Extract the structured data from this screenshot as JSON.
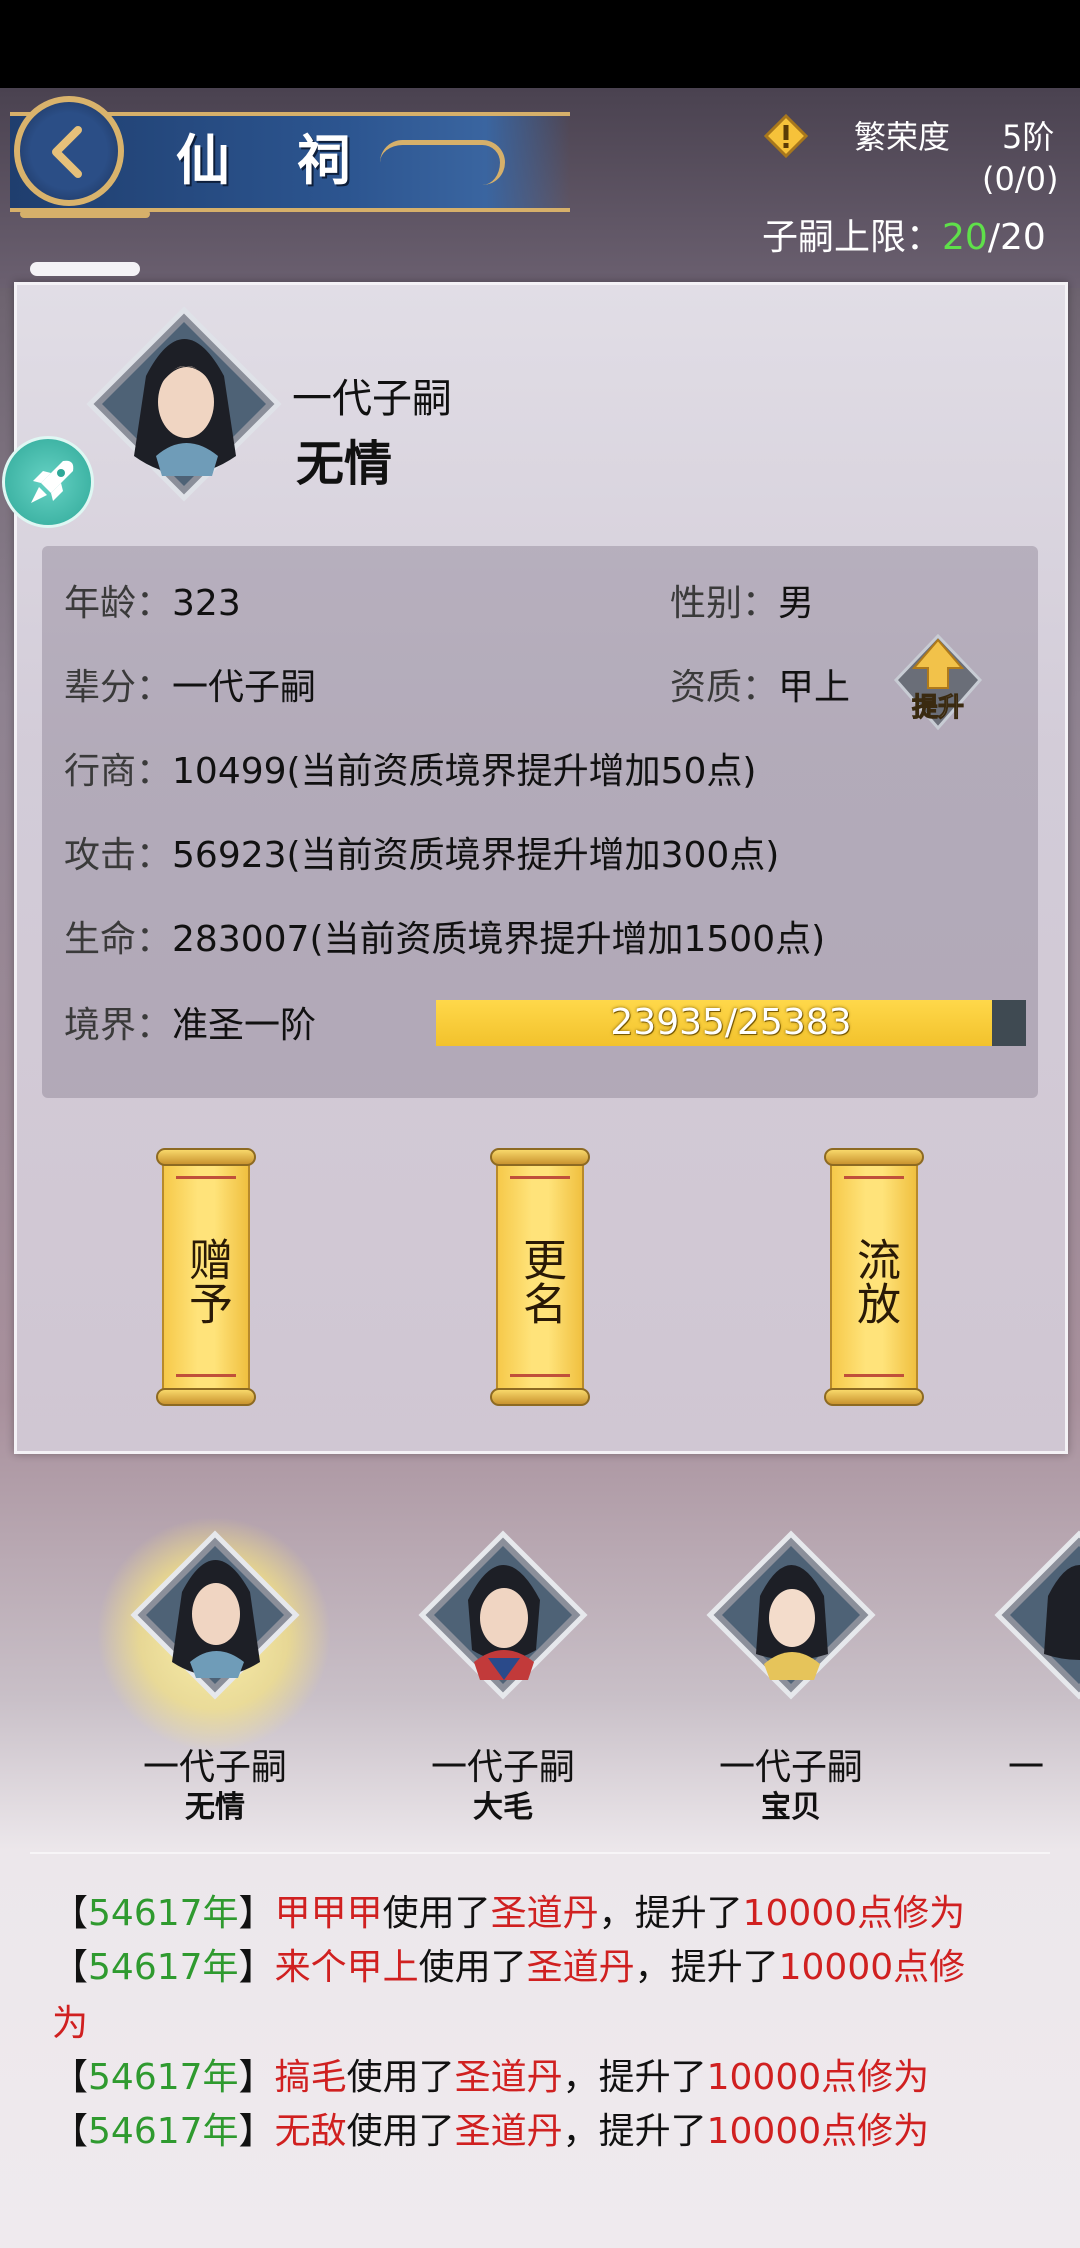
{
  "header": {
    "title": "仙 祠",
    "prosperity_label": "繁荣度",
    "prosperity_rank": "5阶",
    "prosperity_progress": "(0/0)",
    "heir_limit_label": "子嗣上限：",
    "heir_limit_current": "20",
    "heir_limit_max": "/20"
  },
  "heir": {
    "generation": "一代子嗣",
    "name": "无情",
    "stats": {
      "age_label": "年龄：",
      "age": "323",
      "gender_label": "性别：",
      "gender": "男",
      "rank_label": "辈分：",
      "rank": "一代子嗣",
      "aptitude_label": "资质：",
      "aptitude": "甲上",
      "trade_label": "行商：",
      "trade": "10499(当前资质境界提升增加50点)",
      "attack_label": "攻击：",
      "attack": "56923(当前资质境界提升增加300点)",
      "life_label": "生命：",
      "life": "283007(当前资质境界提升增加1500点)",
      "realm_label": "境界：",
      "realm": "准圣一阶",
      "realm_progress": "23935/25383",
      "realm_fraction": 0.943
    },
    "upgrade_label": "提升"
  },
  "actions": [
    {
      "label": "赠予"
    },
    {
      "label": "更名"
    },
    {
      "label": "流放"
    }
  ],
  "heir_list": [
    {
      "generation": "一代子嗣",
      "name": "无情",
      "selected": true
    },
    {
      "generation": "一代子嗣",
      "name": "大毛",
      "selected": false
    },
    {
      "generation": "一代子嗣",
      "name": "宝贝",
      "selected": false
    },
    {
      "generation": "一",
      "name": "",
      "selected": false
    }
  ],
  "log": [
    {
      "open": "【",
      "year": "54617年",
      "close": "】",
      "who": "甲甲甲",
      "mid": "使用了",
      "item": "圣道丹",
      "mid2": "，提升了",
      "amount": "10000点修为",
      "tail": ""
    },
    {
      "open": "【",
      "year": "54617年",
      "close": "】",
      "who": "来个甲上",
      "mid": "使用了",
      "item": "圣道丹",
      "mid2": "，提升了",
      "amount": "10000点修",
      "tail": "为"
    },
    {
      "open": "【",
      "year": "54617年",
      "close": "】",
      "who": "搞毛",
      "mid": "使用了",
      "item": "圣道丹",
      "mid2": "，提升了",
      "amount": "10000点修为",
      "tail": ""
    },
    {
      "open": "【",
      "year": "54617年",
      "close": "】",
      "who": "无敌",
      "mid": "使用了",
      "item": "圣道丹",
      "mid2": "，提升了",
      "amount": "10000点修为",
      "tail": ""
    }
  ],
  "colors": {
    "accent_green": "#5fe04a",
    "log_green": "#2f9a2f",
    "log_red": "#d02020",
    "bar_yellow": "#f2c22c"
  },
  "icons": {
    "back": "chevron-left-icon",
    "warning": "warning-icon",
    "rocket": "rocket-icon",
    "upgrade": "up-arrow-icon"
  }
}
